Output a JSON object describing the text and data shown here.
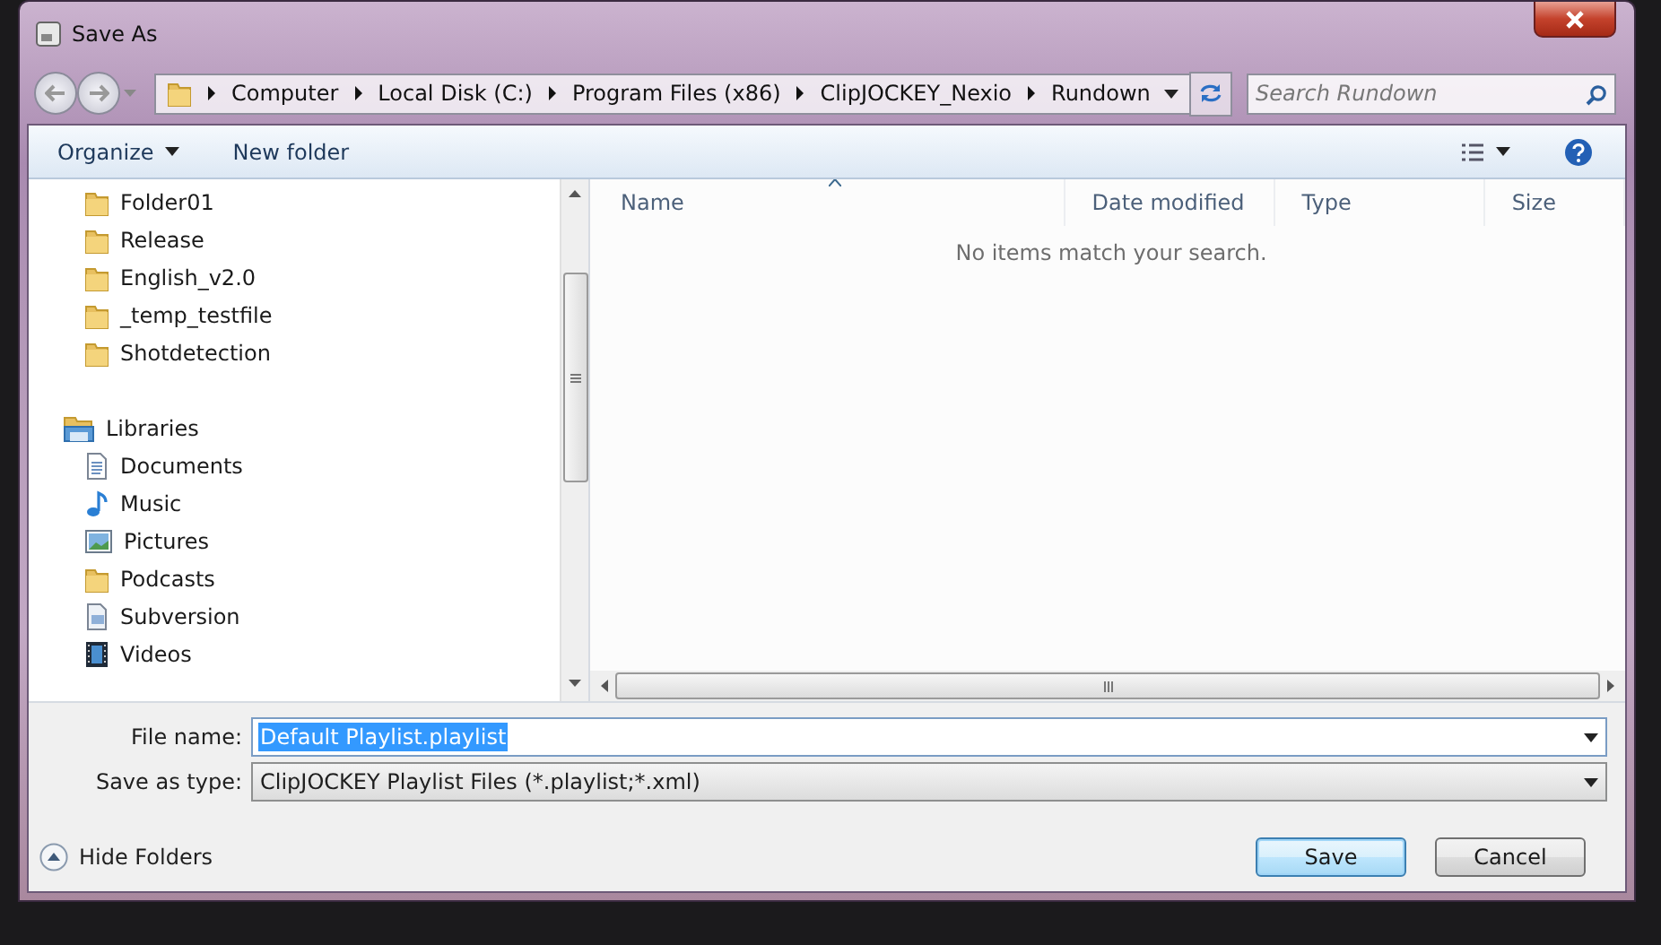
{
  "window": {
    "title": "Save As"
  },
  "address_bar": {
    "segments": [
      "Computer",
      "Local Disk (C:)",
      "Program Files (x86)",
      "ClipJOCKEY_Nexio",
      "Rundown"
    ]
  },
  "search": {
    "placeholder": "Search Rundown"
  },
  "toolbar": {
    "items": [
      {
        "label": "Organize",
        "kind": "menu"
      },
      {
        "label": "New folder",
        "kind": "button"
      }
    ]
  },
  "navigation": {
    "items": [
      {
        "label": "Folder01",
        "kind": "folder"
      },
      {
        "label": "Release",
        "kind": "folder"
      },
      {
        "label": "English_v2.0",
        "kind": "folder"
      },
      {
        "label": "_temp_testfile",
        "kind": "folder"
      },
      {
        "label": "Shotdetection",
        "kind": "folder"
      },
      {
        "label": "Libraries",
        "kind": "library",
        "children": [
          {
            "label": "Documents",
            "kind": "documents"
          },
          {
            "label": "Music",
            "kind": "music"
          },
          {
            "label": "Pictures",
            "kind": "pictures"
          },
          {
            "label": "Podcasts",
            "kind": "folder"
          },
          {
            "label": "Subversion",
            "kind": "subversion"
          },
          {
            "label": "Videos",
            "kind": "videos"
          }
        ]
      }
    ]
  },
  "file_list": {
    "columns": [
      {
        "label": "Name",
        "sorted": true
      },
      {
        "label": "Date modified",
        "sorted": false
      },
      {
        "label": "Type",
        "sorted": false
      },
      {
        "label": "Size",
        "sorted": false
      }
    ],
    "empty_message": "No items match your search."
  },
  "file_name": {
    "label": "File name:",
    "value": "Default Playlist.playlist",
    "selected": true
  },
  "save_as_type": {
    "label": "Save as type:",
    "value": "ClipJOCKEY Playlist Files (*.playlist;*.xml)"
  },
  "hide_folders": {
    "label": "Hide Folders"
  },
  "buttons": [
    {
      "label": "Save",
      "kind": "default"
    },
    {
      "label": "Cancel",
      "kind": "normal"
    }
  ]
}
